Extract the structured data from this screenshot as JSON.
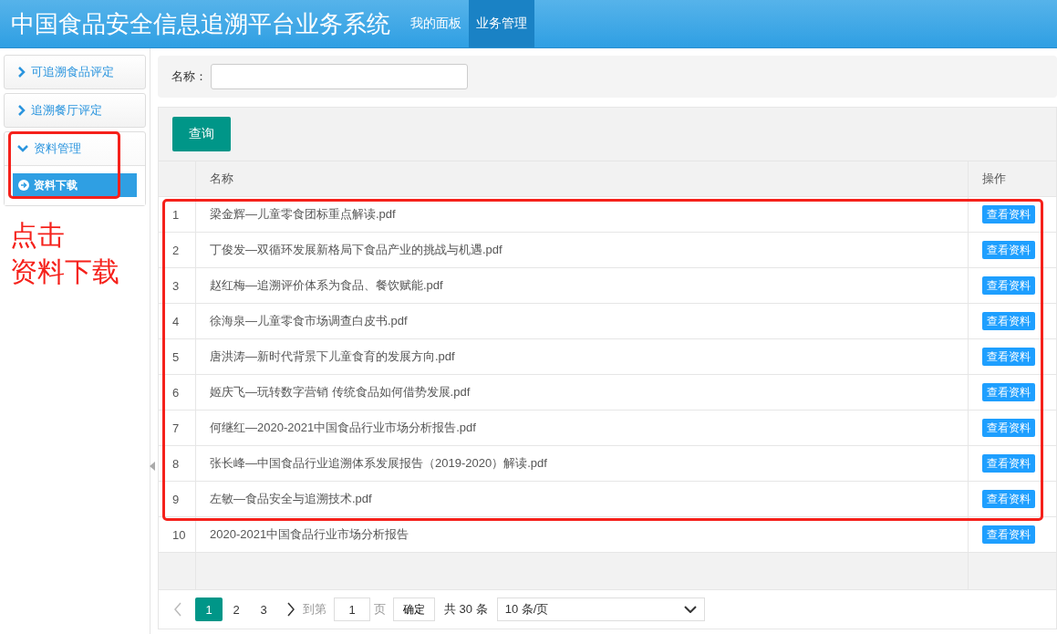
{
  "header": {
    "title": "中国食品安全信息追溯平台业务系统",
    "nav": [
      {
        "label": "我的面板",
        "selected": false
      },
      {
        "label": "业务管理",
        "selected": true
      }
    ]
  },
  "sidebar": {
    "items": [
      {
        "label": "可追溯食品评定",
        "expanded": false
      },
      {
        "label": "追溯餐厅评定",
        "expanded": false
      },
      {
        "label": "资料管理",
        "expanded": true,
        "children": [
          {
            "label": "资料下载",
            "selected": true
          }
        ]
      }
    ]
  },
  "annotation": {
    "lines": [
      "点击",
      "资料下载"
    ]
  },
  "search": {
    "label": "名称："
  },
  "query_button": "查询",
  "table": {
    "columns": [
      "名称",
      "操作"
    ],
    "rows": [
      {
        "index": "1",
        "name": "梁金辉—儿童零食团标重点解读.pdf",
        "action": "查看资料"
      },
      {
        "index": "2",
        "name": "丁俊发—双循环发展新格局下食品产业的挑战与机遇.pdf",
        "action": "查看资料"
      },
      {
        "index": "3",
        "name": "赵红梅—追溯评价体系为食品、餐饮赋能.pdf",
        "action": "查看资料"
      },
      {
        "index": "4",
        "name": "徐海泉—儿童零食市场调查白皮书.pdf",
        "action": "查看资料"
      },
      {
        "index": "5",
        "name": "唐洪涛—新时代背景下儿童食育的发展方向.pdf",
        "action": "查看资料"
      },
      {
        "index": "6",
        "name": "姬庆飞—玩转数字营销 传统食品如何借势发展.pdf",
        "action": "查看资料"
      },
      {
        "index": "7",
        "name": "何继红—2020-2021中国食品行业市场分析报告.pdf",
        "action": "查看资料"
      },
      {
        "index": "8",
        "name": "张长峰—中国食品行业追溯体系发展报告（2019-2020）解读.pdf",
        "action": "查看资料"
      },
      {
        "index": "9",
        "name": "左敏—食品安全与追溯技术.pdf",
        "action": "查看资料"
      },
      {
        "index": "10",
        "name": "2020-2021中国食品行业市场分析报告",
        "action": "查看资料"
      }
    ]
  },
  "pagination": {
    "pages": [
      {
        "label": "1",
        "selected": true
      },
      {
        "label": "2",
        "selected": false
      },
      {
        "label": "3",
        "selected": false
      }
    ],
    "goto_label": "到第",
    "goto_value": "1",
    "page_unit": "页",
    "confirm": "确定",
    "total": "共 30 条",
    "page_size": "10 条/页"
  }
}
